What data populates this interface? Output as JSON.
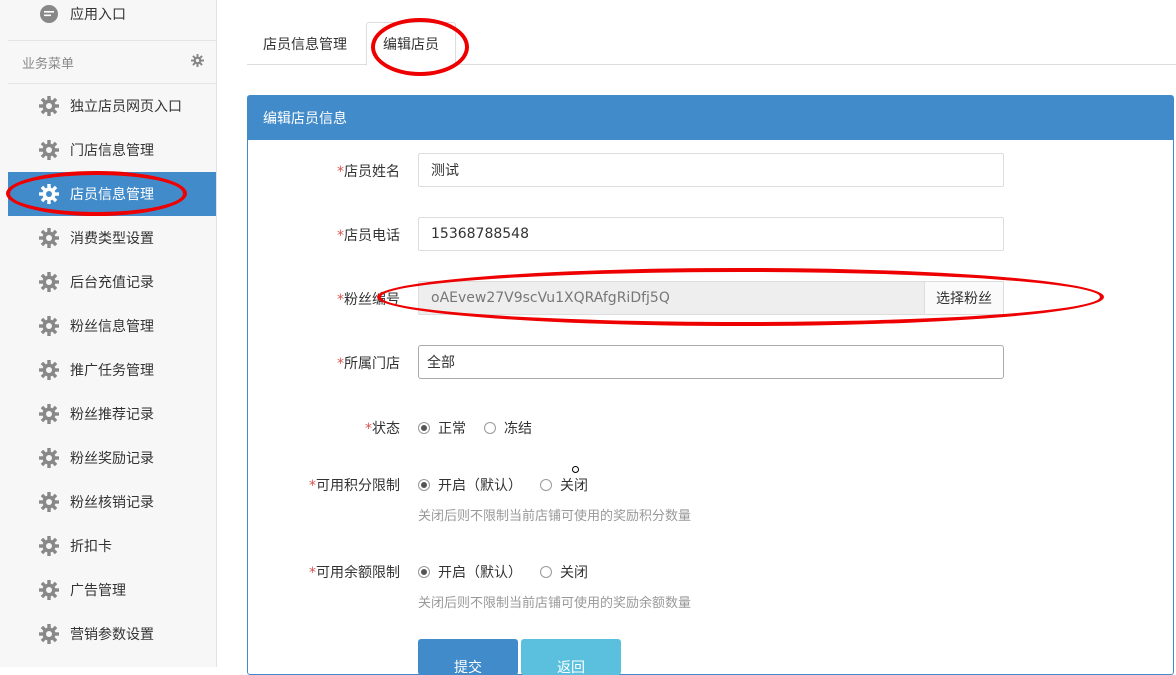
{
  "sidebar": {
    "top_item": {
      "label": "应用入口",
      "icon": "chat-bubble-icon"
    },
    "section_title": "业务菜单",
    "section_icon": "gear-icon",
    "items": [
      {
        "label": "独立店员网页入口",
        "active": false
      },
      {
        "label": "门店信息管理",
        "active": false
      },
      {
        "label": "店员信息管理",
        "active": true
      },
      {
        "label": "消费类型设置",
        "active": false
      },
      {
        "label": "后台充值记录",
        "active": false
      },
      {
        "label": "粉丝信息管理",
        "active": false
      },
      {
        "label": "推广任务管理",
        "active": false
      },
      {
        "label": "粉丝推荐记录",
        "active": false
      },
      {
        "label": "粉丝奖励记录",
        "active": false
      },
      {
        "label": "粉丝核销记录",
        "active": false
      },
      {
        "label": "折扣卡",
        "active": false
      },
      {
        "label": "广告管理",
        "active": false
      },
      {
        "label": "营销参数设置",
        "active": false
      }
    ]
  },
  "tabs": [
    {
      "label": "店员信息管理",
      "active": false
    },
    {
      "label": "编辑店员",
      "active": true
    }
  ],
  "panel": {
    "title": "编辑店员信息",
    "required_mark": "*",
    "fields": {
      "name": {
        "label": "店员姓名",
        "value": "测试"
      },
      "phone": {
        "label": "店员电话",
        "value": "15368788548"
      },
      "fan": {
        "label": "粉丝编号",
        "value": "oAEvew27V9scVu1XQRAfgRiDfj5Q",
        "button": "选择粉丝"
      },
      "store": {
        "label": "所属门店",
        "value": "全部"
      },
      "status": {
        "label": "状态",
        "options": [
          "正常",
          "冻结"
        ],
        "selected": 0
      },
      "points": {
        "label": "可用积分限制",
        "options": [
          "开启（默认）",
          "关闭"
        ],
        "selected": 0,
        "help": "关闭后则不限制当前店铺可使用的奖励积分数量"
      },
      "balance": {
        "label": "可用余额限制",
        "options": [
          "开启（默认）",
          "关闭"
        ],
        "selected": 0,
        "help": "关闭后则不限制当前店铺可使用的奖励余额数量"
      }
    },
    "buttons": {
      "submit": "提交",
      "back": "返回"
    }
  },
  "colors": {
    "primary": "#428bca",
    "info": "#5bc0de",
    "annotation": "#e00000",
    "required": "#d9534f"
  }
}
